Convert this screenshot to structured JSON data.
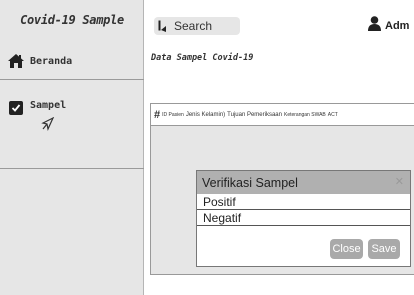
{
  "app": {
    "title": "Covid-19 Sample"
  },
  "sidebar": {
    "items": [
      {
        "label": "Beranda",
        "icon": "home-icon"
      },
      {
        "label": "Sampel",
        "icon": "checkbox-icon"
      }
    ]
  },
  "header": {
    "search_label": "Search",
    "search_icon": "search-icon",
    "user_name": "Adm",
    "user_icon": "user-icon"
  },
  "main": {
    "page_title": "Data Sampel Covid-19",
    "table": {
      "columns": [
        "#",
        "ID Pasien",
        "Jenis Kelamin)",
        "Tujuan Pemeriksaan",
        "Keterangan SWAB",
        "ACT"
      ]
    }
  },
  "modal": {
    "title": "Verifikasi Sampel",
    "options": [
      "Positif",
      "Negatif"
    ],
    "close_label": "Close",
    "save_label": "Save"
  },
  "colors": {
    "sidebar_bg": "#e6e6e6",
    "modal_header": "#b0b0b0",
    "button_bg": "#a9a9a9"
  }
}
